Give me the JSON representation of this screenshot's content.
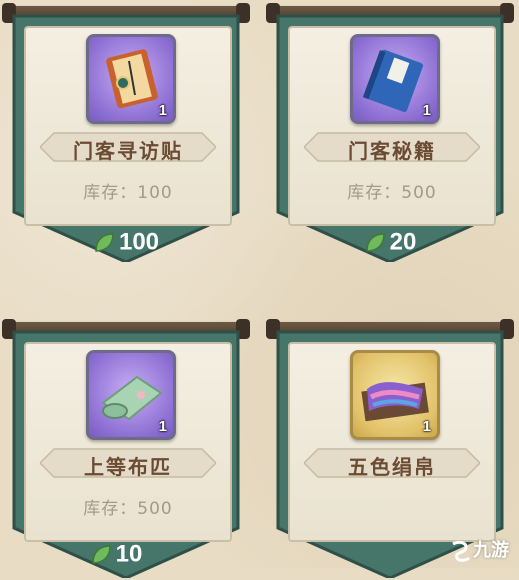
{
  "items": [
    {
      "name": "门客寻访贴",
      "quantity": "1",
      "stock_label": "库存：",
      "stock": "100",
      "price": "100",
      "icon": "letter-scroll-icon",
      "frame": "purple"
    },
    {
      "name": "门客秘籍",
      "quantity": "1",
      "stock_label": "库存：",
      "stock": "500",
      "price": "20",
      "icon": "blue-book-icon",
      "frame": "purple"
    },
    {
      "name": "上等布匹",
      "quantity": "1",
      "stock_label": "库存：",
      "stock": "500",
      "price": "10",
      "icon": "cloth-roll-icon",
      "frame": "purple"
    },
    {
      "name": "五色绢帛",
      "quantity": "1",
      "stock_label": "",
      "stock": "",
      "price": "",
      "icon": "silk-box-icon",
      "frame": "gold"
    }
  ],
  "currency_icon": "jade-leaf-icon",
  "colors": {
    "banner": "#46756a",
    "name_text": "#6b4b33",
    "stock_text": "#a49a88"
  },
  "watermark": "九游"
}
